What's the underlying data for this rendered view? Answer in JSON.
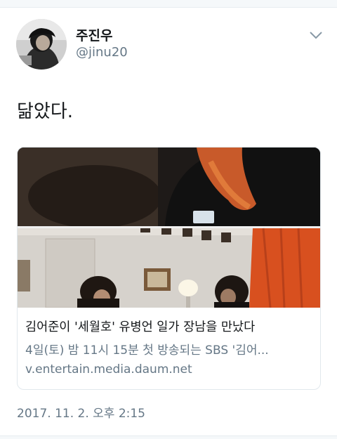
{
  "tweet": {
    "author": {
      "display_name": "주진우",
      "handle": "@jinu20",
      "avatar_icon": "profile-photo"
    },
    "menu_icon": "chevron-down-icon",
    "text": "닮았다.",
    "card": {
      "image_icon": "video-still-photo",
      "title": "김어준이 '세월호' 유병언 일가 장남을 만났다",
      "description": "4일(토) 밤 11시 15분 첫 방송되는 SBS '김어...",
      "domain": "v.entertain.media.daum.net"
    },
    "timestamp": "2017. 11. 2. 오후 2:15"
  },
  "colors": {
    "primary_text": "#14171a",
    "secondary_text": "#657786",
    "border": "#e1e8ed"
  }
}
